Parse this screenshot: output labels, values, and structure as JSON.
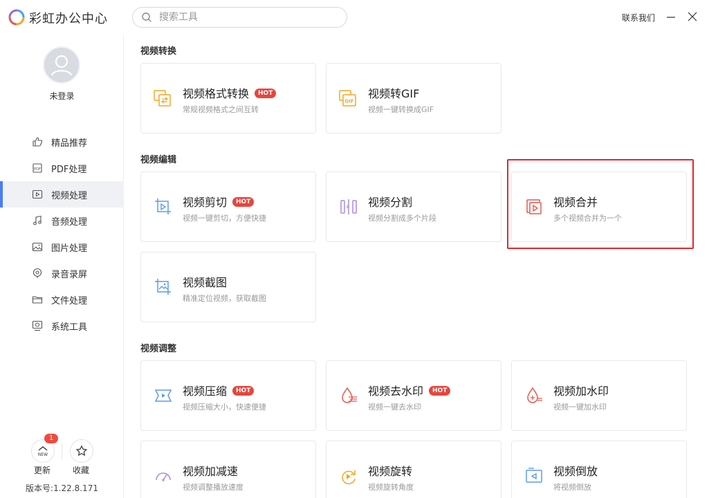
{
  "app": {
    "title": "彩虹办公中心"
  },
  "search": {
    "placeholder": "搜索工具"
  },
  "header": {
    "contact": "联系我们"
  },
  "user": {
    "login_status": "未登录"
  },
  "sidebar": {
    "items": [
      {
        "label": "精品推荐",
        "icon": "thumbs-up-icon"
      },
      {
        "label": "PDF处理",
        "icon": "pdf-icon"
      },
      {
        "label": "视频处理",
        "icon": "video-icon"
      },
      {
        "label": "音频处理",
        "icon": "music-icon"
      },
      {
        "label": "图片处理",
        "icon": "image-icon"
      },
      {
        "label": "录音录屏",
        "icon": "record-icon"
      },
      {
        "label": "文件处理",
        "icon": "folder-icon"
      },
      {
        "label": "系统工具",
        "icon": "system-tool-icon"
      }
    ],
    "active_index": 2,
    "update": {
      "label": "更新",
      "badge": "1",
      "icon_text": "NEW"
    },
    "favorites": {
      "label": "收藏"
    },
    "version": "版本号:1.22.8.171"
  },
  "sections": [
    {
      "title": "视频转换",
      "cards": [
        {
          "title": "视频格式转换",
          "desc": "常规视频格式之间互转",
          "hot": true,
          "icon": "video-format-convert-icon"
        },
        {
          "title": "视频转GIF",
          "desc": "视频一键转换成GIF",
          "hot": false,
          "icon": "video-to-gif-icon"
        }
      ]
    },
    {
      "title": "视频编辑",
      "cards": [
        {
          "title": "视频剪切",
          "desc": "视频一键剪切，方便快捷",
          "hot": true,
          "icon": "video-cut-icon"
        },
        {
          "title": "视频分割",
          "desc": "视频分割成多个片段",
          "hot": false,
          "icon": "video-split-icon"
        },
        {
          "title": "视频合并",
          "desc": "多个视频合并为一个",
          "hot": false,
          "icon": "video-merge-icon"
        },
        {
          "title": "视频截图",
          "desc": "精准定位视频，获取截图",
          "hot": false,
          "icon": "video-screenshot-icon"
        }
      ]
    },
    {
      "title": "视频调整",
      "cards": [
        {
          "title": "视频压缩",
          "desc": "视频压缩大小，快速便捷",
          "hot": true,
          "icon": "video-compress-icon"
        },
        {
          "title": "视频去水印",
          "desc": "视频一键去水印",
          "hot": true,
          "icon": "watermark-remove-icon"
        },
        {
          "title": "视频加水印",
          "desc": "视频一键加水印",
          "hot": false,
          "icon": "watermark-add-icon"
        },
        {
          "title": "视频加减速",
          "desc": "视频调整播放速度",
          "hot": false,
          "icon": "speed-icon"
        },
        {
          "title": "视频旋转",
          "desc": "视频旋转角度",
          "hot": false,
          "icon": "rotate-icon"
        },
        {
          "title": "视频倒放",
          "desc": "将视频倒放",
          "hot": false,
          "icon": "reverse-icon"
        }
      ]
    }
  ],
  "hot_label": "HOT",
  "colors": {
    "accent": "#4a7cf7",
    "hot": "#e8453c",
    "highlight": "#e3262a",
    "orange": "#f5a623",
    "purple": "#a98be0",
    "blue": "#5b9bea",
    "red": "#e8574d"
  }
}
